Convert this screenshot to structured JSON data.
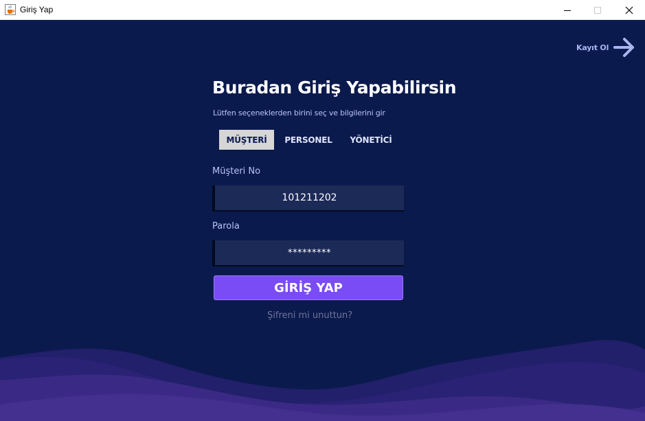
{
  "window": {
    "title": "Giriş Yap",
    "icon": "java-cup-icon"
  },
  "register": {
    "label": "Kayıt Ol",
    "icon": "arrow-right-icon"
  },
  "heading": "Buradan Giriş Yapabilirsin",
  "subheading": "Lütfen seçeneklerden birini seç ve bilgilerini gir",
  "tabs": [
    {
      "label": "MÜŞTERİ",
      "active": true
    },
    {
      "label": "PERSONEL",
      "active": false
    },
    {
      "label": "YÖNETİCİ",
      "active": false
    }
  ],
  "form": {
    "id_label": "Müşteri No",
    "id_value": "101211202",
    "password_label": "Parola",
    "password_value": "*********",
    "submit_label": "GİRİŞ YAP",
    "forgot_label": "Şifreni mi unuttun?"
  },
  "colors": {
    "background": "#0b1a4d",
    "accent": "#7a4cf5",
    "wave": "#3b2a85"
  }
}
